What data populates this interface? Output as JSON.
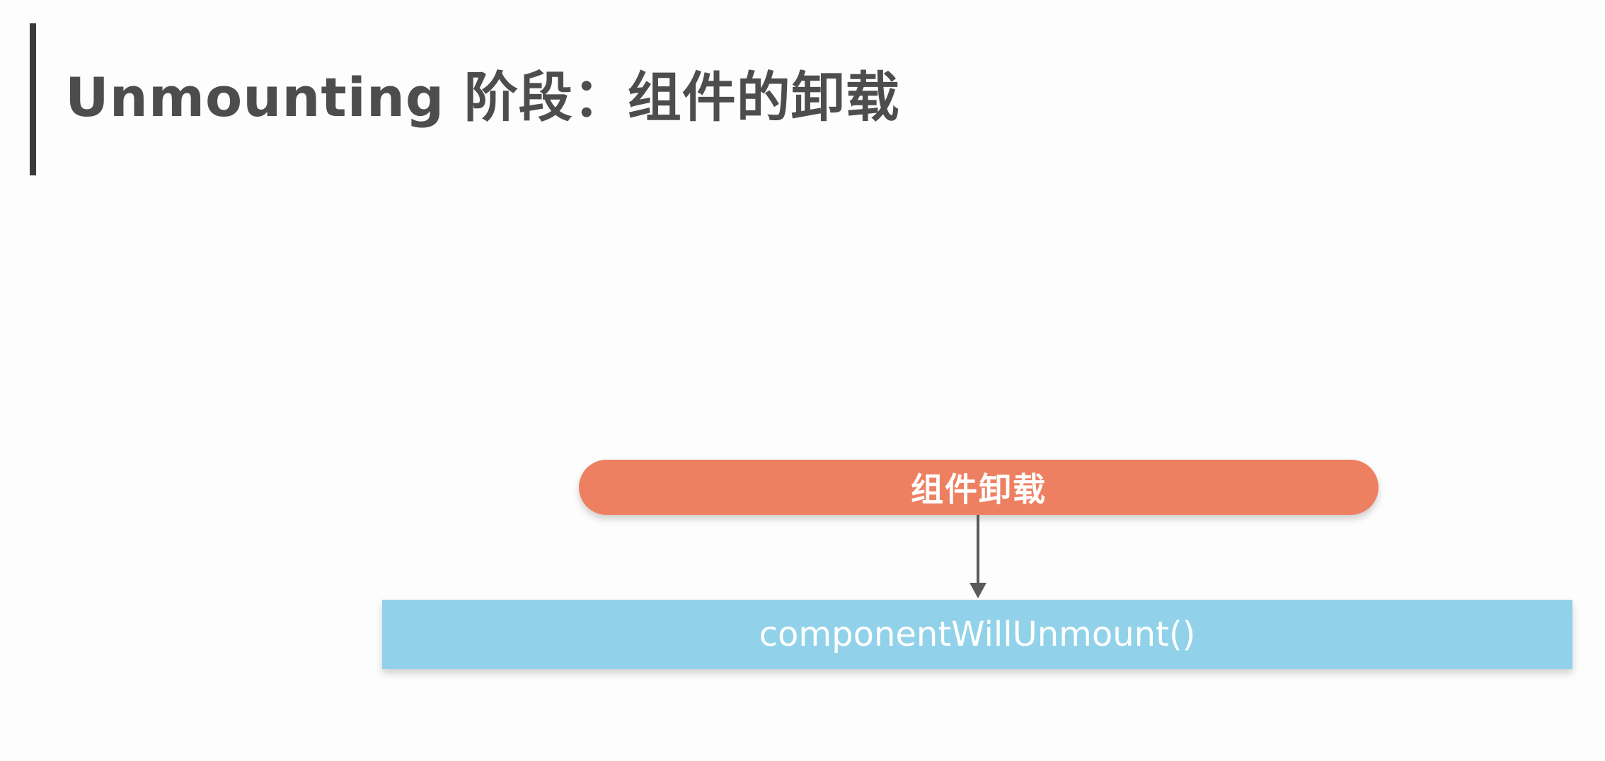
{
  "slide": {
    "title": "Unmounting 阶段：组件的卸载"
  },
  "diagram": {
    "start_node": {
      "label": "组件卸载",
      "color": "#ee8062"
    },
    "method_node": {
      "label": "componentWillUnmount()",
      "color": "#91d2ea"
    },
    "connector": {
      "icon": "arrow-down-icon"
    }
  }
}
